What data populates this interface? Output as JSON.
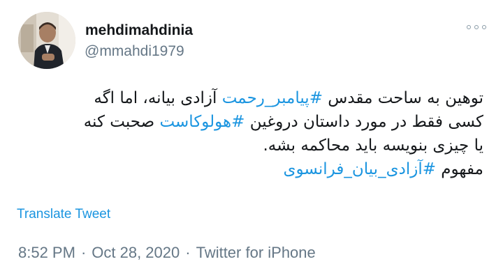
{
  "author": {
    "display_name": "mehdimahdinia",
    "handle": "@mmahdi1979"
  },
  "more_icon": "more-horizontal-icon",
  "tweet": {
    "line1": {
      "before": "توهین به ساحت مقدس ",
      "hashtag": "#پیامبر_رحمت",
      "after": " آزادی بیانه، اما اگه"
    },
    "line2": {
      "before": "کسی فقط در مورد داستان دروغین ",
      "hashtag": "#هولوکاست",
      "after": " صحبت کنه"
    },
    "line3": {
      "text": "یا چیزی بنویسه باید محاکمه بشه."
    },
    "line4": {
      "before": "مفهوم ",
      "hashtag": "#آزادی_بیان_فرانسوی"
    }
  },
  "translate_label": "Translate Tweet",
  "meta": {
    "time": "8:52 PM",
    "date": "Oct 28, 2020",
    "source": "Twitter for iPhone",
    "separator": "·"
  },
  "colors": {
    "link": "#1b95e0",
    "secondary": "#657786",
    "text": "#14171a"
  }
}
